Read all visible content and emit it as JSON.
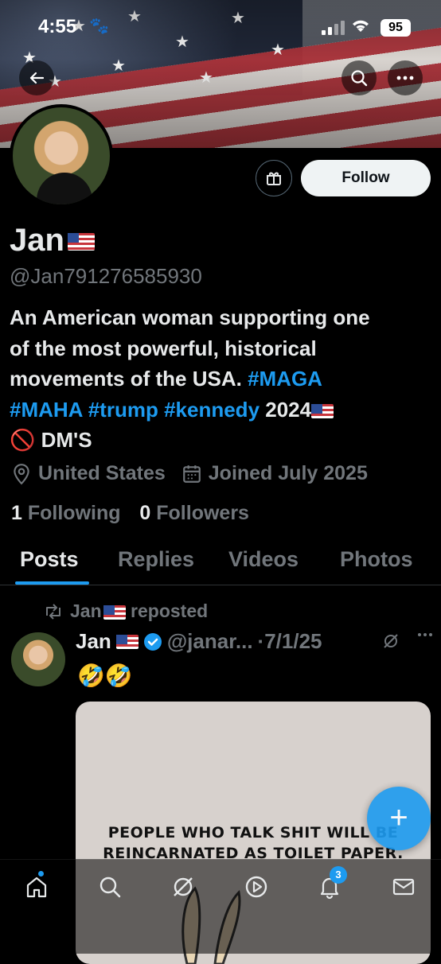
{
  "status_bar": {
    "time": "4:55",
    "battery": "95"
  },
  "profile": {
    "name": "Jan",
    "handle": "@Jan791276585930",
    "follow_label": "Follow",
    "bio": {
      "line1": "An American woman supporting one",
      "line2": "of the most powerful, historical",
      "line3_text": "movements of the USA. ",
      "tag_maga": "#MAGA",
      "tag_maha": "#MAHA",
      "tag_trump": "#trump",
      "tag_kennedy": "#kennedy",
      "year": "2024",
      "dms": "DM'S"
    },
    "location": "United States",
    "joined": "Joined July 2025",
    "following_count": "1",
    "following_label": "Following",
    "followers_count": "0",
    "followers_label": "Followers"
  },
  "tabs": [
    {
      "label": "Posts",
      "active": true
    },
    {
      "label": "Replies"
    },
    {
      "label": "Videos"
    },
    {
      "label": "Photos"
    }
  ],
  "post": {
    "repost_name": "Jan",
    "repost_label": "reposted",
    "author_name": "Jan",
    "author_handle": "@janar...",
    "date": "·7/1/25",
    "text": "🤣🤣",
    "media_caption_line1": "PEOPLE WHO TALK SHIT WILL BE",
    "media_caption_line2": "REINCARNATED AS TOILET PAPER."
  },
  "fab_label": "+",
  "bottom_nav": {
    "notifications_badge": "3",
    "items": [
      "home-icon",
      "search-icon",
      "grok-icon",
      "video-icon",
      "bell-icon",
      "mail-icon"
    ]
  },
  "colors": {
    "accent": "#1d9bf0",
    "background": "#000000",
    "muted": "#71767b"
  }
}
